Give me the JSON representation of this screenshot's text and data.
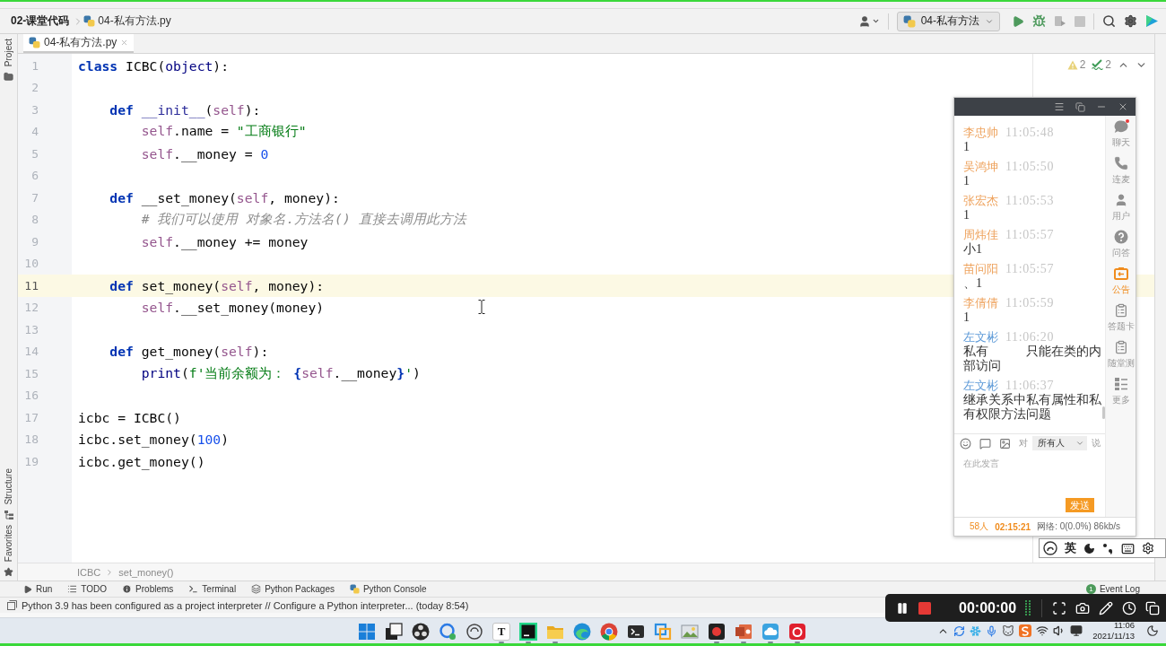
{
  "nav_bar": {
    "project": "02-课堂代码",
    "file": "04-私有方法.py",
    "run_config": "04-私有方法"
  },
  "tool_strip": {
    "top": [
      {
        "kind": "project",
        "label": "Project"
      }
    ],
    "bottom": [
      {
        "kind": "structure",
        "label": "Structure"
      },
      {
        "kind": "favorites",
        "label": "Favorites"
      }
    ]
  },
  "tabs": [
    {
      "label": "04-私有方法.py",
      "selected": true
    }
  ],
  "editor": {
    "inspections": [
      {
        "kind": "warning",
        "count": "2"
      },
      {
        "kind": "typo",
        "count": "2"
      }
    ],
    "lines": [
      {
        "number": "1",
        "current": false,
        "tokens": [
          {
            "kind": "keyword",
            "text": "class"
          },
          {
            "kind": "plain",
            "text": " ICBC("
          },
          {
            "kind": "builtin",
            "text": "object"
          },
          {
            "kind": "plain",
            "text": "):"
          }
        ]
      },
      {
        "number": "2",
        "current": false
      },
      {
        "number": "3",
        "current": false,
        "tokens": [
          {
            "kind": "keyword",
            "text": "    def"
          },
          {
            "kind": "special",
            "text": " __init__"
          },
          {
            "kind": "plain",
            "text": "("
          },
          {
            "kind": "self",
            "text": "self"
          },
          {
            "kind": "plain",
            "text": "):"
          }
        ]
      },
      {
        "number": "4",
        "current": false,
        "tokens": [
          {
            "kind": "self",
            "text": "        self"
          },
          {
            "kind": "plain",
            "text": ".name = "
          },
          {
            "kind": "string",
            "text": "\"工商银行\""
          }
        ]
      },
      {
        "number": "5",
        "current": false,
        "tokens": [
          {
            "kind": "self",
            "text": "        self"
          },
          {
            "kind": "plain",
            "text": ".__money = "
          },
          {
            "kind": "number",
            "text": "0"
          }
        ]
      },
      {
        "number": "6",
        "current": false
      },
      {
        "number": "7",
        "current": false,
        "tokens": [
          {
            "kind": "keyword",
            "text": "    def"
          },
          {
            "kind": "plain",
            "text": " __set_money("
          },
          {
            "kind": "self",
            "text": "self"
          },
          {
            "kind": "plain",
            "text": ", money):"
          }
        ]
      },
      {
        "number": "8",
        "current": false,
        "tokens": [
          {
            "kind": "comment",
            "text": "        # 我们可以使用 对象名.方法名() 直接去调用此方法"
          }
        ]
      },
      {
        "number": "9",
        "current": false,
        "tokens": [
          {
            "kind": "self",
            "text": "        self"
          },
          {
            "kind": "plain",
            "text": ".__money += money"
          }
        ]
      },
      {
        "number": "10",
        "current": false
      },
      {
        "number": "11",
        "current": true,
        "tokens": [
          {
            "kind": "keyword",
            "text": "    def"
          },
          {
            "kind": "plain",
            "text": " set_money("
          },
          {
            "kind": "self",
            "text": "self"
          },
          {
            "kind": "plain",
            "text": ", money):"
          }
        ]
      },
      {
        "number": "12",
        "current": false,
        "tokens": [
          {
            "kind": "self",
            "text": "        self"
          },
          {
            "kind": "plain",
            "text": ".__set_money(money)"
          }
        ]
      },
      {
        "number": "13",
        "current": false
      },
      {
        "number": "14",
        "current": false,
        "tokens": [
          {
            "kind": "keyword",
            "text": "    def"
          },
          {
            "kind": "plain",
            "text": " get_money("
          },
          {
            "kind": "self",
            "text": "self"
          },
          {
            "kind": "plain",
            "text": "):"
          }
        ]
      },
      {
        "number": "15",
        "current": false,
        "tokens": [
          {
            "kind": "builtin",
            "text": "        print"
          },
          {
            "kind": "plain",
            "text": "("
          },
          {
            "kind": "string",
            "text": "f'当前余额为： "
          },
          {
            "kind": "brace",
            "text": "{"
          },
          {
            "kind": "self",
            "text": "self"
          },
          {
            "kind": "plain",
            "text": ".__money"
          },
          {
            "kind": "brace",
            "text": "}"
          },
          {
            "kind": "string",
            "text": "'"
          },
          {
            "kind": "plain",
            "text": ")"
          }
        ]
      },
      {
        "number": "16",
        "current": false
      },
      {
        "number": "17",
        "current": false,
        "tokens": [
          {
            "kind": "plain",
            "text": "icbc = ICBC()"
          }
        ]
      },
      {
        "number": "18",
        "current": false,
        "tokens": [
          {
            "kind": "plain",
            "text": "icbc.set_money("
          },
          {
            "kind": "number",
            "text": "100"
          },
          {
            "kind": "plain",
            "text": ")"
          }
        ]
      },
      {
        "number": "19",
        "current": false,
        "tokens": [
          {
            "kind": "plain",
            "text": "icbc.get_money()"
          }
        ]
      }
    ]
  },
  "breadcrumb": [
    "ICBC",
    "set_money()"
  ],
  "tool_windows": [
    {
      "kind": "run",
      "label": "Run"
    },
    {
      "kind": "todo",
      "label": "TODO"
    },
    {
      "kind": "problems",
      "label": "Problems"
    },
    {
      "kind": "terminal",
      "label": "Terminal"
    },
    {
      "kind": "packages",
      "label": "Python Packages"
    },
    {
      "kind": "console",
      "label": "Python Console"
    }
  ],
  "event_log": {
    "badge": "1",
    "label": "Event Log"
  },
  "status_bar": {
    "message": "Python 3.9 has been configured as a project interpreter // Configure a Python interpreter... (today 8:54)"
  },
  "chat": {
    "messages": [
      {
        "name": "李忠帅",
        "time": "11:05:48",
        "text": "1",
        "color": "#eea25c"
      },
      {
        "name": "吴鸿坤",
        "time": "11:05:50",
        "text": "1",
        "color": "#eea25c"
      },
      {
        "name": "张宏杰",
        "time": "11:05:53",
        "text": "1",
        "color": "#eea25c"
      },
      {
        "name": "周炜佳",
        "time": "11:05:57",
        "text": "小1",
        "color": "#eea25c"
      },
      {
        "name": "苗问阳",
        "time": "11:05:57",
        "text": "、1",
        "color": "#eea25c"
      },
      {
        "name": "李倩倩",
        "time": "11:05:59",
        "text": "1",
        "color": "#eea25c"
      },
      {
        "name": "左文彬",
        "time": "11:06:20",
        "text": "私有　　　只能在类的内部访问",
        "color": "#5d9ad8"
      },
      {
        "name": "左文彬",
        "time": "11:06:37",
        "text": "继承关系中私有属性和私有权限方法问题",
        "color": "#5d9ad8"
      }
    ],
    "recipient": {
      "prefix": "对",
      "value": "所有人",
      "suffix": "说"
    },
    "placeholder": "在此发言",
    "send": "发送",
    "sidebar": [
      {
        "kind": "chat",
        "label": "聊天",
        "selected": false,
        "unread": true
      },
      {
        "kind": "call",
        "label": "连麦",
        "selected": false,
        "unread": false
      },
      {
        "kind": "users",
        "label": "用户",
        "selected": false,
        "unread": false
      },
      {
        "kind": "qa",
        "label": "问答",
        "selected": false,
        "unread": false
      },
      {
        "kind": "notice",
        "label": "公告",
        "selected": true,
        "unread": false
      },
      {
        "kind": "answer-card",
        "label": "答题卡",
        "selected": false,
        "unread": false
      },
      {
        "kind": "quiz",
        "label": "随堂测",
        "selected": false,
        "unread": false
      },
      {
        "kind": "more",
        "label": "更多",
        "selected": false,
        "unread": false
      }
    ],
    "footer": {
      "attendees": "58人",
      "duration": "02:15:21",
      "network": "网络: 0(0.0%) 86kb/s"
    }
  },
  "ime_bar": {
    "mode": "英"
  },
  "recorder": {
    "time": "00:00:00"
  },
  "taskbar": {
    "apps": [
      {
        "kind": "start",
        "running": false
      },
      {
        "kind": "task-view",
        "running": false
      },
      {
        "kind": "obs",
        "running": false
      },
      {
        "kind": "chat",
        "running": false
      },
      {
        "kind": "ring",
        "running": false
      },
      {
        "kind": "letter",
        "glyph": "T",
        "running": true
      },
      {
        "kind": "pycharm",
        "running": true
      },
      {
        "kind": "folder",
        "running": true
      },
      {
        "kind": "edge",
        "running": false
      },
      {
        "kind": "chrome",
        "running": false
      },
      {
        "kind": "terminal",
        "running": false
      },
      {
        "kind": "vm",
        "running": false
      },
      {
        "kind": "photos",
        "running": false
      },
      {
        "kind": "recorder",
        "running": true
      },
      {
        "kind": "slides",
        "running": true
      },
      {
        "kind": "cloud",
        "running": true
      },
      {
        "kind": "music",
        "running": true
      }
    ],
    "time": "11:06",
    "date": "2021/11/13"
  }
}
